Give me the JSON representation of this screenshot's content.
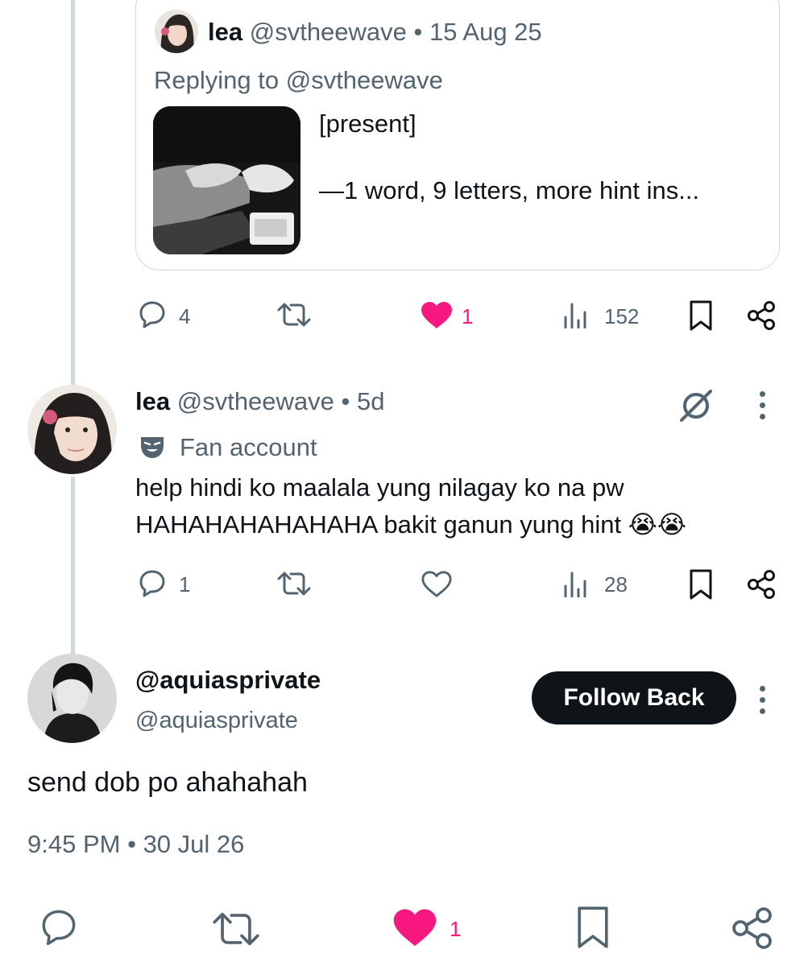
{
  "quoted_tweet": {
    "name": "lea",
    "handle": "@svtheewave",
    "separator": "•",
    "date": "15 Aug 25",
    "replying_to_prefix": "Replying to",
    "replying_to_handle": "@svtheewave",
    "line1": "[present]",
    "line2": "—1 word, 9 letters, more hint ins..."
  },
  "quote_actions": {
    "replies": "4",
    "likes": "1",
    "views": "152",
    "liked": true
  },
  "reply_tweet": {
    "name": "lea",
    "handle": "@svtheewave",
    "separator": "•",
    "time": "5d",
    "badge_label": "Fan account",
    "text_line1": "help hindi ko maalala yung nilagay ko na pw",
    "text_line2": "HAHAHAHAHAHAHA bakit ganun yung hint",
    "emoji": "😭😭"
  },
  "reply_actions": {
    "replies": "1",
    "views": "28",
    "liked": false
  },
  "main_tweet": {
    "display_name": "@aquiasprivate",
    "handle": "@aquiasprivate",
    "follow_label": "Follow Back",
    "text": "send dob po ahahahah",
    "time": "9:45 PM",
    "separator": "•",
    "date": "30 Jul 26"
  },
  "main_actions": {
    "likes": "1",
    "liked": true
  },
  "colors": {
    "like_pink": "#f91880",
    "muted": "#536471",
    "text": "#0f1419",
    "border": "#cfd9de"
  }
}
